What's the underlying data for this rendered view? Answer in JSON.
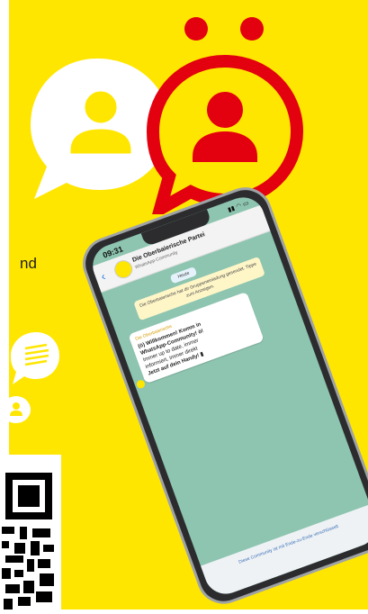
{
  "page": {
    "side_text": "nd",
    "colors": {
      "background": "#ffe600",
      "accent_red": "#e3000f",
      "chat_bg": "#8ec5b0"
    }
  },
  "icons": {
    "white_bubble": "user-speech-bubble-icon",
    "red_bubble": "umlaut-user-speech-bubble-icon",
    "small_chat": "chat-lines-icon",
    "small_user": "user-icon",
    "qr": "qr-code-icon"
  },
  "phone": {
    "status_time": "09:31",
    "status_icons": "▮▮ ◠ ▭",
    "chat_title": "Die Oberbaierische Partei",
    "chat_subtitle": "WhatsApp-Community",
    "date_chip": "Heute",
    "system_message": "Die Oberbaierische hat dir Gruppeneinladung gesendet. Tippe zum Anzeigen.",
    "message": {
      "sender": "Die Oberbaierische",
      "lines": [
        "(ö) Willkommen! Komm in",
        "WhatsApp-Community! ö!",
        "Immer up to date, immer",
        "informiert, immer direkt",
        "Jetzt auf dein Handy! ▮"
      ]
    },
    "footer_text": "Diese Community ist mit Ende-zu-Ende verschlüsselt"
  }
}
